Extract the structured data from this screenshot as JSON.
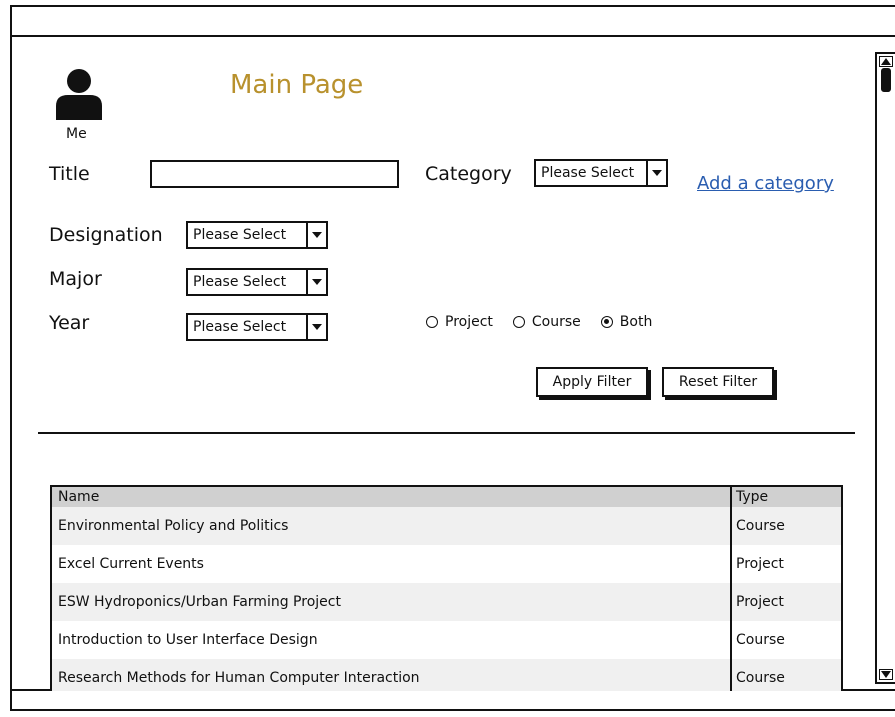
{
  "header": {
    "avatar_label": "Me",
    "title": "Main Page"
  },
  "filters": {
    "title_label": "Title",
    "title_value": "",
    "category_label": "Category",
    "category_value": "Please Select",
    "add_category_link": "Add a category",
    "designation_label": "Designation",
    "designation_value": "Please Select",
    "major_label": "Major",
    "major_value": "Please Select",
    "year_label": "Year",
    "year_value": "Please Select",
    "type_options": [
      {
        "label": "Project",
        "selected": false
      },
      {
        "label": "Course",
        "selected": false
      },
      {
        "label": "Both",
        "selected": true
      }
    ],
    "apply_label": "Apply Filter",
    "reset_label": "Reset Filter"
  },
  "table": {
    "columns": [
      "Name",
      "Type"
    ],
    "rows": [
      {
        "name": "Environmental Policy and Politics",
        "type": "Course"
      },
      {
        "name": "Excel Current Events",
        "type": "Project"
      },
      {
        "name": "ESW Hydroponics/Urban Farming Project",
        "type": "Project"
      },
      {
        "name": "Introduction to User Interface Design",
        "type": "Course"
      },
      {
        "name": "Research Methods for Human Computer Interaction",
        "type": "Course"
      }
    ]
  },
  "colors": {
    "title": "#b8912d",
    "link": "#2a5db0",
    "header_row": "#d0d0d0"
  }
}
